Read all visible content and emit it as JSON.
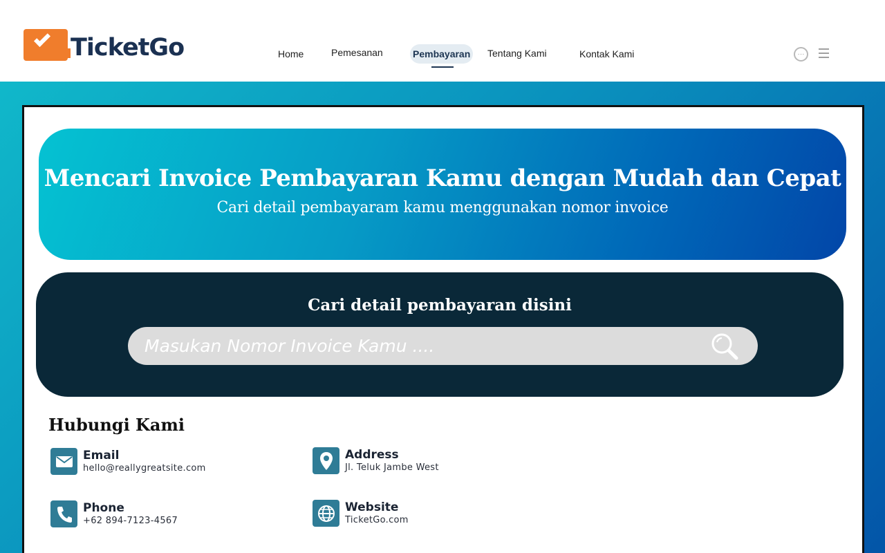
{
  "brand": {
    "name": "TicketGo"
  },
  "nav": {
    "items": [
      {
        "label": "Home"
      },
      {
        "label": "Pemesanan"
      },
      {
        "label": "Pembayaran"
      },
      {
        "label": "Tentang Kami"
      },
      {
        "label": "Kontak Kami"
      }
    ],
    "active_index": 2
  },
  "hero": {
    "title": "Mencari Invoice Pembayaran Kamu dengan Mudah dan Cepat",
    "subtitle": "Cari detail pembayaram kamu menggunakan nomor invoice"
  },
  "search": {
    "title": "Cari detail pembayaran disini",
    "placeholder": "Masukan Nomor Invoice Kamu ....",
    "value": ""
  },
  "contact": {
    "title": "Hubungi Kami",
    "items": [
      {
        "label": "Email",
        "value": "hello@reallygreatsite.com",
        "icon": "mail-icon"
      },
      {
        "label": "Address",
        "value": "Jl. Teluk Jambe West",
        "icon": "location-pin-icon"
      },
      {
        "label": "Phone",
        "value": "+62 894-7123-4567",
        "icon": "phone-icon"
      },
      {
        "label": "Website",
        "value": "TicketGo.com",
        "icon": "globe-icon"
      }
    ]
  },
  "colors": {
    "brand_orange": "#f07d2c",
    "brand_navy": "#1b3152",
    "search_panel": "#0a2838",
    "contact_icon_bg": "#2f7c96"
  }
}
